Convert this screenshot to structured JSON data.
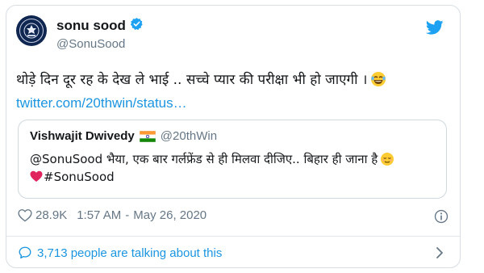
{
  "author": {
    "display_name": "sonu sood",
    "handle": "@SonuSood",
    "avatar_icon": "police-emblem-icon",
    "verified_icon": "verified-badge-icon"
  },
  "tweet": {
    "text": "थोड़े दिन दूर रह के देख ले भाई .. सच्चे प्यार की परीक्षा भी हो जाएगी ।",
    "emoji": "laughing-tears-emoji-icon",
    "link": "twitter.com/20thwin/status…"
  },
  "quoted_tweet": {
    "display_name": "Vishwajit Dwivedy",
    "flag_icon": "india-flag-icon",
    "handle": "@20thWin",
    "text_line1": "@SonuSood भैया, एक बार गर्लफ्रेंड से ही मिलवा दीजिए.. बिहार ही जाना है",
    "line1_emoji": "relieved-face-emoji-icon",
    "text_line2": "#SonuSood",
    "line2_emoji": "red-heart-icon"
  },
  "meta": {
    "likes": "28.9K",
    "time": "1:57 AM",
    "date_separator": "-",
    "date": "May 26, 2020"
  },
  "footer": {
    "talking": "3,713 people are talking about this"
  },
  "colors": {
    "link": "#1b95e0",
    "muted": "#657786",
    "text": "#14171a",
    "verified": "#1da1f2"
  }
}
